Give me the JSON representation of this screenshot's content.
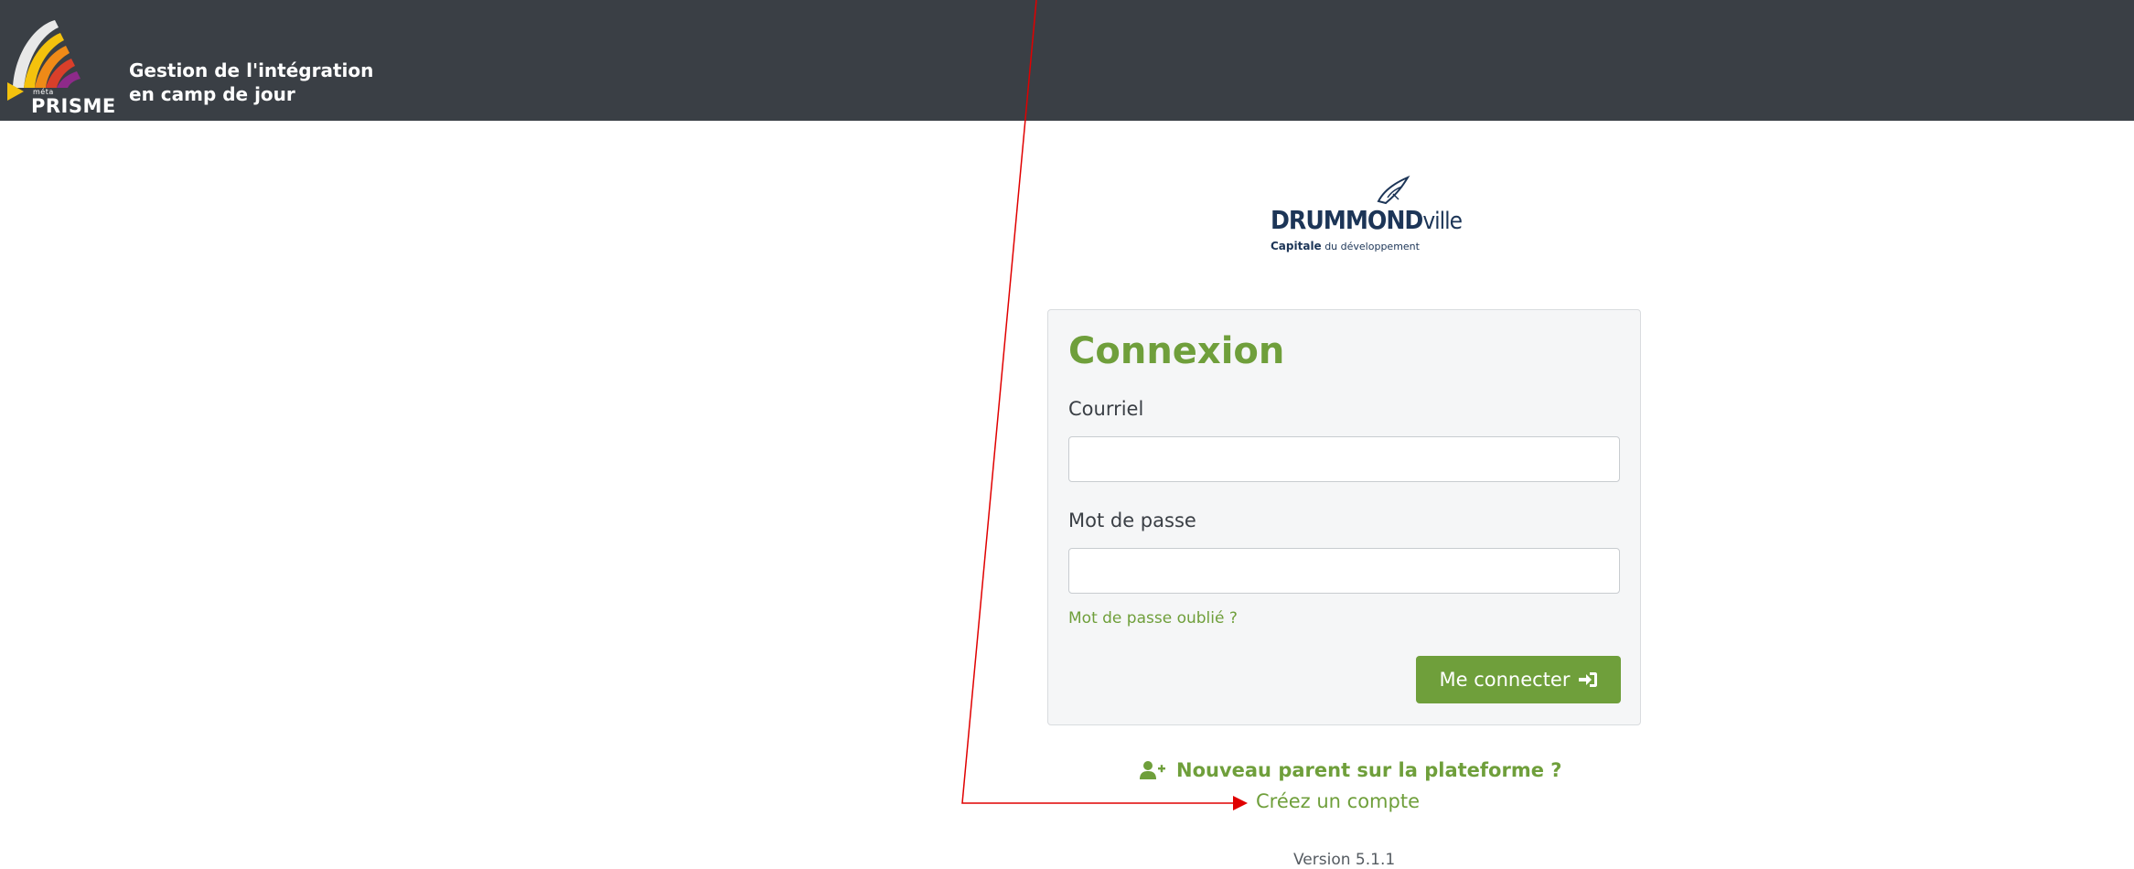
{
  "header": {
    "brand": {
      "small": "méta",
      "name": "PRISME"
    },
    "title_line1": "Gestion de l'intégration",
    "title_line2": "en camp de jour"
  },
  "city_logo": {
    "name_bold": "DRUMMOND",
    "name_light": "ville",
    "tag_bold": "Capitale",
    "tag_rest": " du développement"
  },
  "login": {
    "title": "Connexion",
    "email_label": "Courriel",
    "email_value": "",
    "password_label": "Mot de passe",
    "password_value": "",
    "forgot_link": "Mot de passe oublié ?",
    "submit_label": "Me connecter"
  },
  "signup": {
    "question": "Nouveau parent sur la plateforme ?",
    "link": "Créez un compte"
  },
  "footer": {
    "version": "Version 5.1.1"
  },
  "colors": {
    "header_bg": "#3a3f45",
    "accent_green": "#6f9f3b",
    "city_blue": "#1c3557",
    "annotation_red": "#e00000"
  },
  "icons": {
    "submit": "sign-in-icon",
    "signup": "user-plus-icon"
  }
}
